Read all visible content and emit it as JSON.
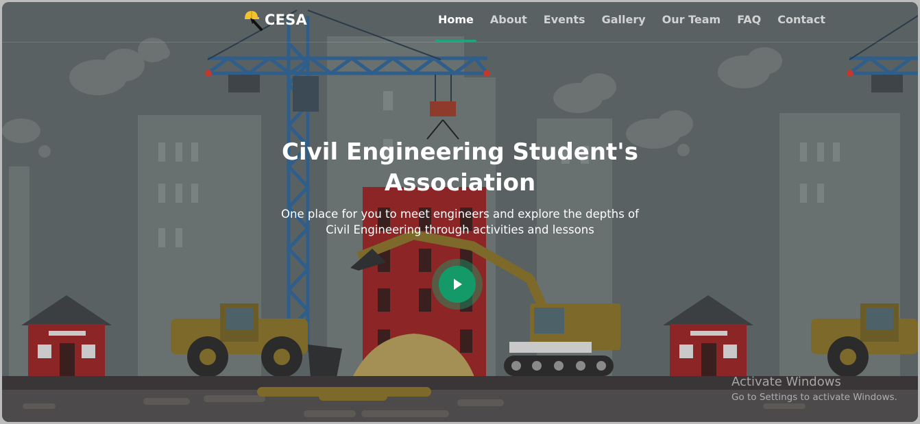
{
  "brand": {
    "name": "CESA",
    "icon": "hardhat-wrench-icon"
  },
  "nav": {
    "items": [
      {
        "label": "Home",
        "active": true
      },
      {
        "label": "About",
        "active": false
      },
      {
        "label": "Events",
        "active": false
      },
      {
        "label": "Gallery",
        "active": false
      },
      {
        "label": "Our Team",
        "active": false
      },
      {
        "label": "FAQ",
        "active": false
      },
      {
        "label": "Contact",
        "active": false
      }
    ]
  },
  "hero": {
    "title_line1": "Civil Engineering Student's",
    "title_line2": "Association",
    "subtitle_line1": "One place for you to meet engineers and explore the depths of",
    "subtitle_line2": "Civil Engineering through activities and lessons",
    "play_icon": "play-icon"
  },
  "watermark": {
    "title": "Activate Windows",
    "subtitle": "Go to Settings to activate Windows."
  },
  "colors": {
    "accent": "#139a68",
    "overlay": "#5a6162"
  }
}
